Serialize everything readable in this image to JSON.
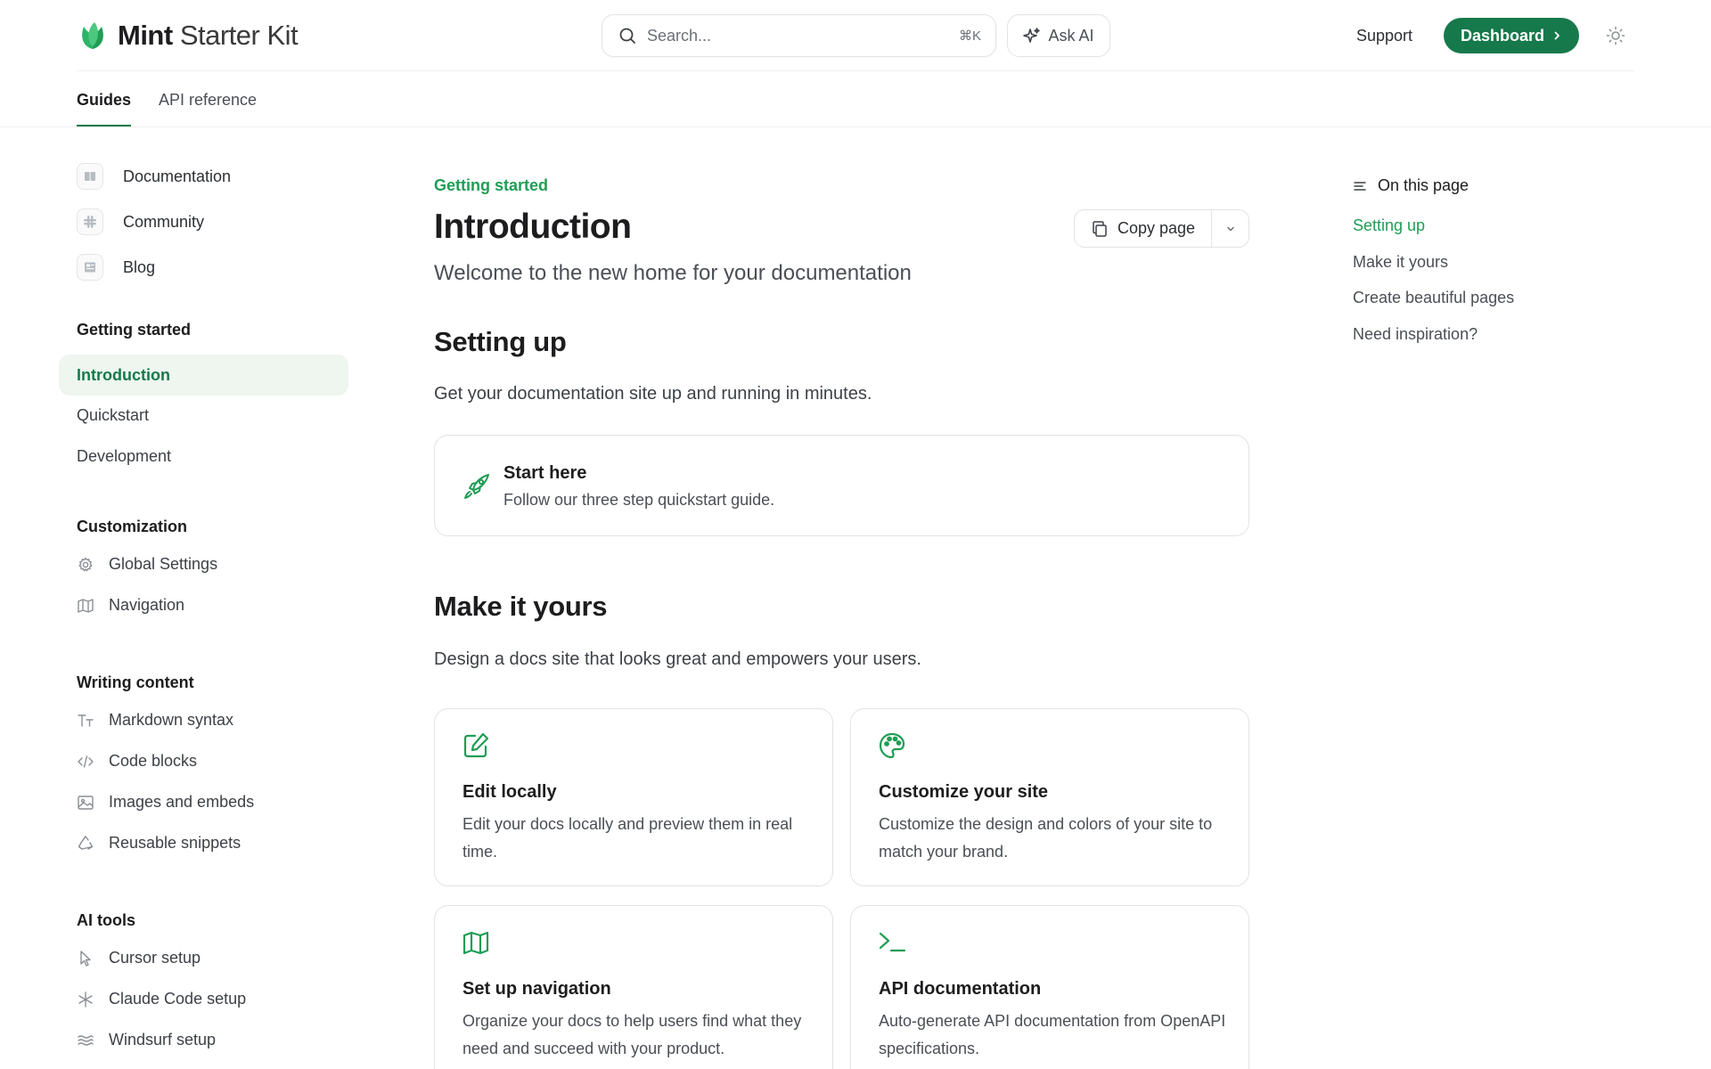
{
  "brand": {
    "name_bold": "Mint",
    "name_rest": "Starter Kit",
    "accent": "#16794b",
    "accent_light": "#1f9d55"
  },
  "header": {
    "search": {
      "placeholder": "Search...",
      "shortcut": "⌘K"
    },
    "ask_ai_label": "Ask AI",
    "support_label": "Support",
    "dashboard_label": "Dashboard"
  },
  "tabs": [
    {
      "label": "Guides",
      "active": true
    },
    {
      "label": "API reference",
      "active": false
    }
  ],
  "sidebar": {
    "links": [
      {
        "label": "Documentation",
        "icon": "book-icon"
      },
      {
        "label": "Community",
        "icon": "slack-icon"
      },
      {
        "label": "Blog",
        "icon": "newspaper-icon"
      }
    ],
    "groups": [
      {
        "heading": "Getting started",
        "items": [
          "Introduction",
          "Quickstart",
          "Development"
        ],
        "active": "Introduction"
      },
      {
        "heading": "Customization",
        "items": [
          {
            "label": "Global Settings",
            "icon": "gear-icon"
          },
          {
            "label": "Navigation",
            "icon": "map-icon"
          }
        ]
      },
      {
        "heading": "Writing content",
        "items": [
          {
            "label": "Markdown syntax",
            "icon": "text-size-icon"
          },
          {
            "label": "Code blocks",
            "icon": "code-icon"
          },
          {
            "label": "Images and embeds",
            "icon": "image-icon"
          },
          {
            "label": "Reusable snippets",
            "icon": "recycle-icon"
          }
        ]
      },
      {
        "heading": "AI tools",
        "items": [
          {
            "label": "Cursor setup",
            "icon": "cursor-icon"
          },
          {
            "label": "Claude Code setup",
            "icon": "asterisk-icon"
          },
          {
            "label": "Windsurf setup",
            "icon": "waves-icon"
          }
        ]
      }
    ]
  },
  "main": {
    "eyebrow": "Getting started",
    "title": "Introduction",
    "copy_label": "Copy page",
    "subtitle": "Welcome to the new home for your documentation",
    "sections": [
      {
        "heading": "Setting up",
        "text": "Get your documentation site up and running in minutes."
      },
      {
        "heading": "Make it yours",
        "text": "Design a docs site that looks great and empowers your users."
      }
    ],
    "start_card": {
      "title": "Start here",
      "desc": "Follow our three step quickstart guide.",
      "icon": "rocket-icon"
    },
    "cards": [
      {
        "title": "Edit locally",
        "desc": "Edit your docs locally and preview them in real time.",
        "icon": "pencil-square-icon"
      },
      {
        "title": "Customize your site",
        "desc": "Customize the design and colors of your site to match your brand.",
        "icon": "palette-icon"
      },
      {
        "title": "Set up navigation",
        "desc": "Organize your docs to help users find what they need and succeed with your product.",
        "icon": "map-icon"
      },
      {
        "title": "API documentation",
        "desc": "Auto-generate API documentation from OpenAPI specifications.",
        "icon": "terminal-icon"
      }
    ]
  },
  "toc": {
    "heading": "On this page",
    "items": [
      "Setting up",
      "Make it yours",
      "Create beautiful pages",
      "Need inspiration?"
    ],
    "active": "Setting up"
  }
}
